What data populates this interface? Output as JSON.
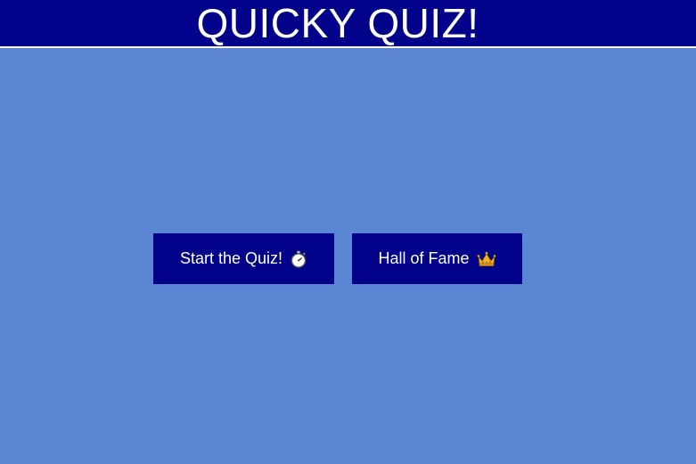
{
  "header": {
    "title": "QUICKY QUIZ!"
  },
  "buttons": {
    "start": {
      "label": "Start the Quiz!",
      "icon": "stopwatch-icon"
    },
    "hall_of_fame": {
      "label": "Hall of Fame",
      "icon": "crown-icon"
    }
  },
  "colors": {
    "background": "#5b86d4",
    "header_and_buttons": "#01018a",
    "text": "#ffffff",
    "crown": "#f2b321"
  }
}
